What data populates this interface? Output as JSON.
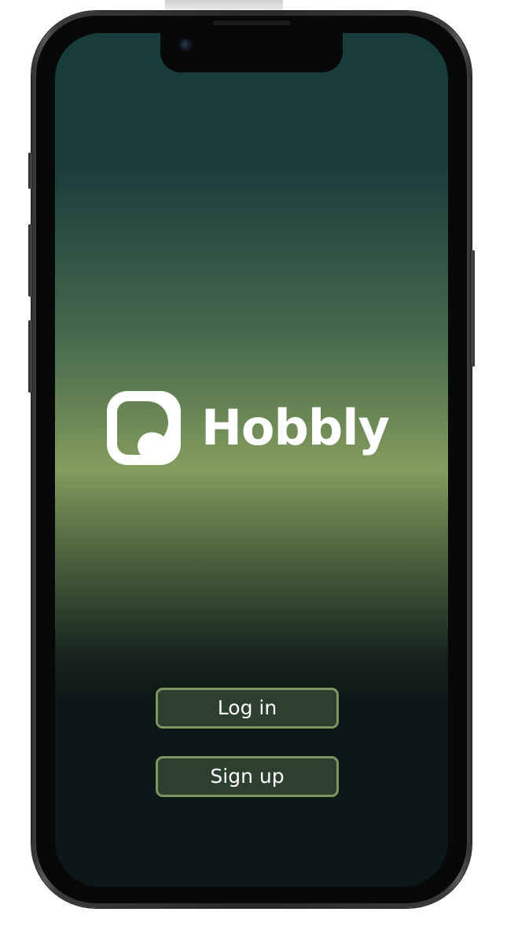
{
  "app": {
    "brand_name": "Hobbly",
    "logo_icon": "hobbly-logo-icon"
  },
  "actions": {
    "login_label": "Log in",
    "signup_label": "Sign up"
  },
  "colors": {
    "button_background": "#2d4030",
    "button_border": "#7d9561",
    "gradient_top": "#183b3c",
    "gradient_middle": "#849c5e",
    "gradient_bottom": "#0b1817",
    "text": "#ffffff"
  }
}
